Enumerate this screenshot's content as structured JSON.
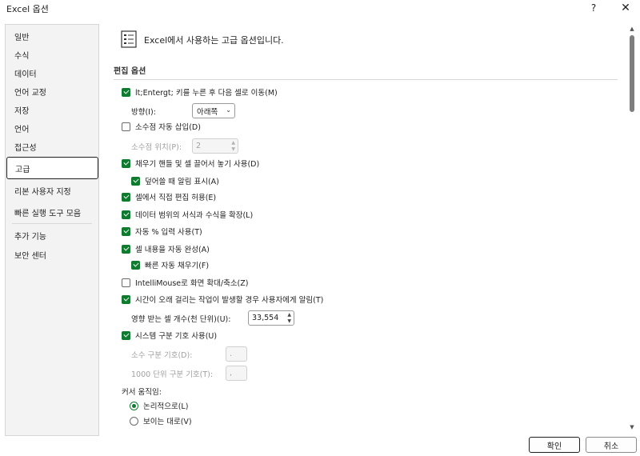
{
  "window": {
    "title": "Excel 옵션",
    "help_icon": "question-mark",
    "close_icon": "close-x"
  },
  "sidebar": {
    "items": [
      {
        "label": "일반"
      },
      {
        "label": "수식"
      },
      {
        "label": "데이터"
      },
      {
        "label": "언어 교정"
      },
      {
        "label": "저장"
      },
      {
        "label": "언어"
      },
      {
        "label": "접근성"
      },
      {
        "label": "고급",
        "selected": true
      },
      {
        "label": "리본 사용자 지정"
      },
      {
        "label": "빠른 실행 도구 모음"
      },
      {
        "label": "추가 기능"
      },
      {
        "label": "보안 센터"
      }
    ]
  },
  "header": {
    "text": "Excel에서 사용하는 고급 옵션입니다.",
    "icon": "options-list-icon"
  },
  "section": {
    "title": "편집 옵션"
  },
  "options": {
    "move_after_enter": {
      "label": "lt;Entergt; 키를 누른 후 다음 셀로 이동(M)",
      "checked": true
    },
    "direction": {
      "label": "방향(I):",
      "value": "아래쪽"
    },
    "auto_decimal": {
      "label": "소수점 자동 삽입(D)",
      "checked": false
    },
    "decimal_places": {
      "label": "소수점 위치(P):",
      "value": "2"
    },
    "fill_handle": {
      "label": "채우기 핸들 및 셀 끌어서 놓기 사용(D)",
      "checked": true
    },
    "alert_overwrite": {
      "label": "덮어쓸 때 알림 표시(A)",
      "checked": true
    },
    "edit_in_cell": {
      "label": "셀에서 직접 편집 허용(E)",
      "checked": true
    },
    "extend_formats": {
      "label": "데이터 범위의 서식과 수식을 확장(L)",
      "checked": true
    },
    "auto_percent": {
      "label": "자동 % 입력 사용(T)",
      "checked": true
    },
    "autocomplete": {
      "label": "셀 내용을 자동 완성(A)",
      "checked": true
    },
    "flash_fill": {
      "label": "빠른 자동 채우기(F)",
      "checked": true
    },
    "intellimouse": {
      "label": "IntelliMouse로 화면 확대/축소(Z)",
      "checked": false
    },
    "long_op_alert": {
      "label": "시간이 오래 걸리는 작업이 발생할 경우 사용자에게 알림(T)",
      "checked": true
    },
    "cells_affected": {
      "label": "영향 받는 셀 개수(천 단위)(U):",
      "value": "33,554"
    },
    "system_separators": {
      "label": "시스템 구분 기호 사용(U)",
      "checked": true
    },
    "decimal_separator": {
      "label": "소수 구분 기호(D):",
      "value": "."
    },
    "thousands_separator": {
      "label": "1000 단위 구분 기호(T):",
      "value": ","
    },
    "cursor_movement": {
      "label": "커서 움직임:"
    },
    "cursor_logical": {
      "label": "논리적으로(L)",
      "selected": true
    },
    "cursor_visual": {
      "label": "보이는 대로(V)",
      "selected": false
    }
  },
  "buttons": {
    "ok": "확인",
    "cancel": "취소"
  },
  "colors": {
    "accent": "#0f7b2e",
    "selected_border": "#1f1f1f",
    "sidebar_bg": "#f3f3f3"
  }
}
